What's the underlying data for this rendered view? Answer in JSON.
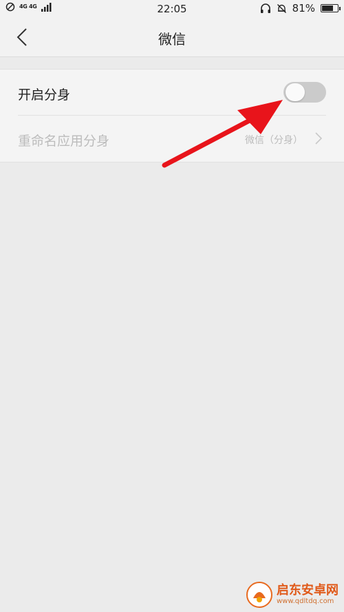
{
  "status_bar": {
    "network_top": "4G 4G",
    "time": "22:05",
    "battery_percent": "81%",
    "battery_level": 0.81,
    "icons": [
      "do-not-disturb-icon",
      "signal-icon",
      "headset-icon",
      "bell-muted-icon",
      "battery-icon"
    ]
  },
  "header": {
    "title": "微信",
    "back_icon": "chevron-left-icon"
  },
  "settings": {
    "enable_clone": {
      "label": "开启分身",
      "enabled": false
    },
    "rename_clone": {
      "label": "重命名应用分身",
      "value": "微信（分身）",
      "disabled": true
    }
  },
  "annotation": {
    "arrow_color": "#e8141b"
  },
  "watermark": {
    "title": "启东安卓网",
    "url": "www.qdltdq.com"
  }
}
